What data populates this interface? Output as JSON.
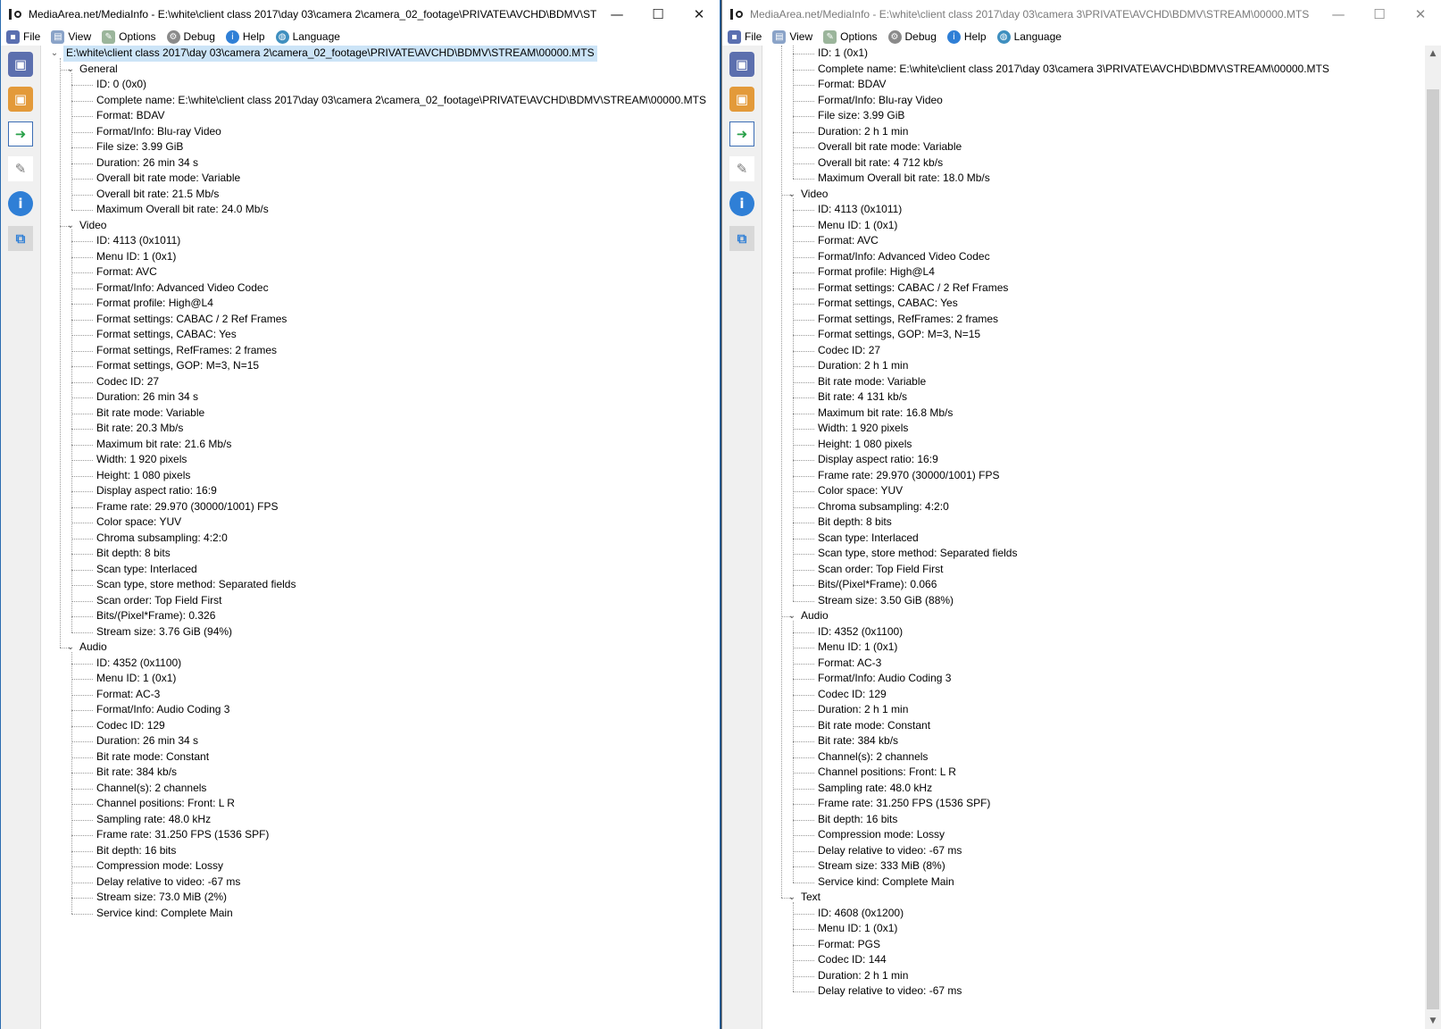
{
  "left": {
    "title": "MediaArea.net/MediaInfo - E:\\white\\client class 2017\\day 03\\camera 2\\camera_02_footage\\PRIVATE\\AVCHD\\BDMV\\ST...",
    "root": "E:\\white\\client class 2017\\day 03\\camera 2\\camera_02_footage\\PRIVATE\\AVCHD\\BDMV\\STREAM\\00000.MTS",
    "sections": [
      {
        "name": "General",
        "items": [
          "ID: 0 (0x0)",
          "Complete name: E:\\white\\client class 2017\\day 03\\camera 2\\camera_02_footage\\PRIVATE\\AVCHD\\BDMV\\STREAM\\00000.MTS",
          "Format: BDAV",
          "Format/Info: Blu-ray Video",
          "File size: 3.99 GiB",
          "Duration: 26 min 34 s",
          "Overall bit rate mode: Variable",
          "Overall bit rate: 21.5 Mb/s",
          "Maximum Overall bit rate: 24.0 Mb/s"
        ]
      },
      {
        "name": "Video",
        "items": [
          "ID: 4113 (0x1011)",
          "Menu ID: 1 (0x1)",
          "Format: AVC",
          "Format/Info: Advanced Video Codec",
          "Format profile: High@L4",
          "Format settings: CABAC / 2 Ref Frames",
          "Format settings, CABAC: Yes",
          "Format settings, RefFrames: 2 frames",
          "Format settings, GOP: M=3, N=15",
          "Codec ID: 27",
          "Duration: 26 min 34 s",
          "Bit rate mode: Variable",
          "Bit rate: 20.3 Mb/s",
          "Maximum bit rate: 21.6 Mb/s",
          "Width: 1 920 pixels",
          "Height: 1 080 pixels",
          "Display aspect ratio: 16:9",
          "Frame rate: 29.970 (30000/1001) FPS",
          "Color space: YUV",
          "Chroma subsampling: 4:2:0",
          "Bit depth: 8 bits",
          "Scan type: Interlaced",
          "Scan type, store method: Separated fields",
          "Scan order: Top Field First",
          "Bits/(Pixel*Frame): 0.326",
          "Stream size: 3.76 GiB (94%)"
        ]
      },
      {
        "name": "Audio",
        "items": [
          "ID: 4352 (0x1100)",
          "Menu ID: 1 (0x1)",
          "Format: AC-3",
          "Format/Info: Audio Coding 3",
          "Codec ID: 129",
          "Duration: 26 min 34 s",
          "Bit rate mode: Constant",
          "Bit rate: 384 kb/s",
          "Channel(s): 2 channels",
          "Channel positions: Front: L R",
          "Sampling rate: 48.0 kHz",
          "Frame rate: 31.250 FPS (1536 SPF)",
          "Bit depth: 16 bits",
          "Compression mode: Lossy",
          "Delay relative to video: -67 ms",
          "Stream size: 73.0 MiB (2%)",
          "Service kind: Complete Main"
        ]
      }
    ]
  },
  "right": {
    "title": "MediaArea.net/MediaInfo - E:\\white\\client class 2017\\day 03\\camera 3\\PRIVATE\\AVCHD\\BDMV\\STREAM\\00000.MTS",
    "general_items": [
      "ID: 1 (0x1)",
      "Complete name: E:\\white\\client class 2017\\day 03\\camera 3\\PRIVATE\\AVCHD\\BDMV\\STREAM\\00000.MTS",
      "Format: BDAV",
      "Format/Info: Blu-ray Video",
      "File size: 3.99 GiB",
      "Duration: 2 h 1 min",
      "Overall bit rate mode: Variable",
      "Overall bit rate: 4 712 kb/s",
      "Maximum Overall bit rate: 18.0 Mb/s"
    ],
    "sections": [
      {
        "name": "Video",
        "items": [
          "ID: 4113 (0x1011)",
          "Menu ID: 1 (0x1)",
          "Format: AVC",
          "Format/Info: Advanced Video Codec",
          "Format profile: High@L4",
          "Format settings: CABAC / 2 Ref Frames",
          "Format settings, CABAC: Yes",
          "Format settings, RefFrames: 2 frames",
          "Format settings, GOP: M=3, N=15",
          "Codec ID: 27",
          "Duration: 2 h 1 min",
          "Bit rate mode: Variable",
          "Bit rate: 4 131 kb/s",
          "Maximum bit rate: 16.8 Mb/s",
          "Width: 1 920 pixels",
          "Height: 1 080 pixels",
          "Display aspect ratio: 16:9",
          "Frame rate: 29.970 (30000/1001) FPS",
          "Color space: YUV",
          "Chroma subsampling: 4:2:0",
          "Bit depth: 8 bits",
          "Scan type: Interlaced",
          "Scan type, store method: Separated fields",
          "Scan order: Top Field First",
          "Bits/(Pixel*Frame): 0.066",
          "Stream size: 3.50 GiB (88%)"
        ]
      },
      {
        "name": "Audio",
        "items": [
          "ID: 4352 (0x1100)",
          "Menu ID: 1 (0x1)",
          "Format: AC-3",
          "Format/Info: Audio Coding 3",
          "Codec ID: 129",
          "Duration: 2 h 1 min",
          "Bit rate mode: Constant",
          "Bit rate: 384 kb/s",
          "Channel(s): 2 channels",
          "Channel positions: Front: L R",
          "Sampling rate: 48.0 kHz",
          "Frame rate: 31.250 FPS (1536 SPF)",
          "Bit depth: 16 bits",
          "Compression mode: Lossy",
          "Delay relative to video: -67 ms",
          "Stream size: 333 MiB (8%)",
          "Service kind: Complete Main"
        ]
      },
      {
        "name": "Text",
        "items": [
          "ID: 4608 (0x1200)",
          "Menu ID: 1 (0x1)",
          "Format: PGS",
          "Codec ID: 144",
          "Duration: 2 h 1 min",
          "Delay relative to video: -67 ms"
        ]
      }
    ]
  },
  "menu": {
    "file": "File",
    "view": "View",
    "options": "Options",
    "debug": "Debug",
    "help": "Help",
    "language": "Language"
  },
  "window_buttons": {
    "minimize": "—",
    "maximize": "☐",
    "close": "✕"
  },
  "icons": {
    "toolbar": [
      "open-file-icon",
      "open-folder-icon",
      "export-icon",
      "preferences-icon",
      "info-icon",
      "about-icon"
    ]
  }
}
